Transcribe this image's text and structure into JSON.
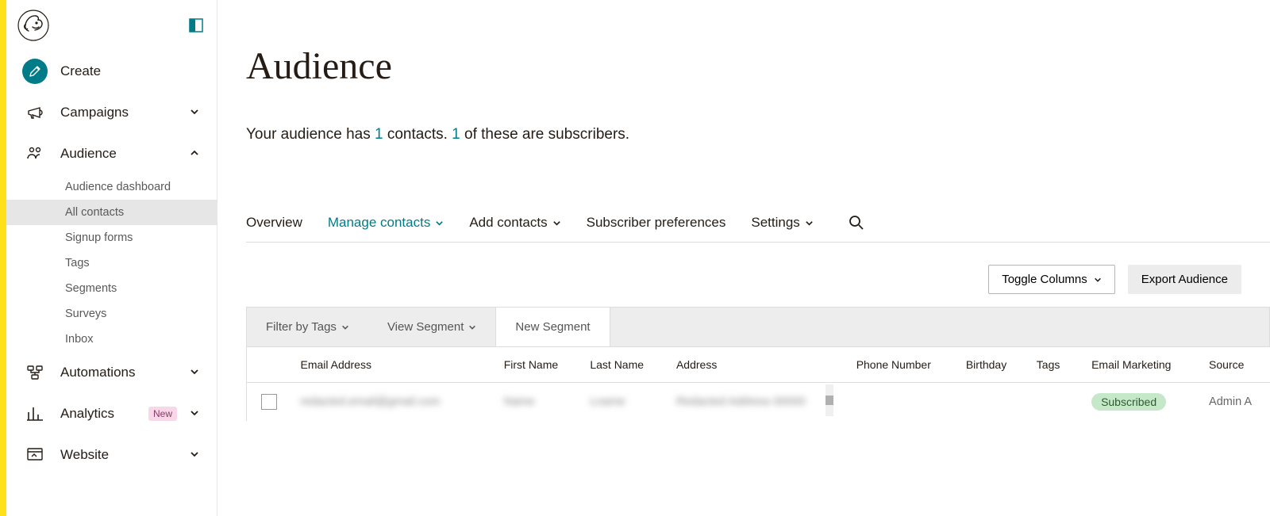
{
  "sidebar": {
    "create": "Create",
    "items": [
      {
        "label": "Campaigns",
        "expanded": false
      },
      {
        "label": "Audience",
        "expanded": true,
        "children": [
          {
            "label": "Audience dashboard",
            "active": false
          },
          {
            "label": "All contacts",
            "active": true
          },
          {
            "label": "Signup forms",
            "active": false
          },
          {
            "label": "Tags",
            "active": false
          },
          {
            "label": "Segments",
            "active": false
          },
          {
            "label": "Surveys",
            "active": false
          },
          {
            "label": "Inbox",
            "active": false
          }
        ]
      },
      {
        "label": "Automations",
        "expanded": false
      },
      {
        "label": "Analytics",
        "expanded": false,
        "badge": "New"
      },
      {
        "label": "Website",
        "expanded": false
      }
    ]
  },
  "page": {
    "title": "Audience",
    "summary_prefix": "Your audience has ",
    "contacts_count": "1",
    "summary_mid1": " contacts. ",
    "subscribers_count": "1",
    "summary_mid2": " of these are subscribers."
  },
  "tabs": {
    "overview": "Overview",
    "manage": "Manage contacts",
    "add": "Add contacts",
    "prefs": "Subscriber preferences",
    "settings": "Settings"
  },
  "toolbar": {
    "toggle_columns": "Toggle Columns",
    "export": "Export Audience"
  },
  "filters": {
    "by_tags": "Filter by Tags",
    "view_segment": "View Segment",
    "new_segment": "New Segment"
  },
  "table": {
    "headers": {
      "email": "Email Address",
      "first_name": "First Name",
      "last_name": "Last Name",
      "address": "Address",
      "phone": "Phone Number",
      "birthday": "Birthday",
      "tags": "Tags",
      "marketing": "Email Marketing",
      "source": "Source"
    },
    "rows": [
      {
        "email": "redacted.email@gmail.com",
        "first_name": "Name",
        "last_name": "Lname",
        "address": "Redacted Address 00000",
        "phone": "",
        "birthday": "",
        "tags": "",
        "marketing": "Subscribed",
        "source": "Admin A"
      }
    ]
  }
}
